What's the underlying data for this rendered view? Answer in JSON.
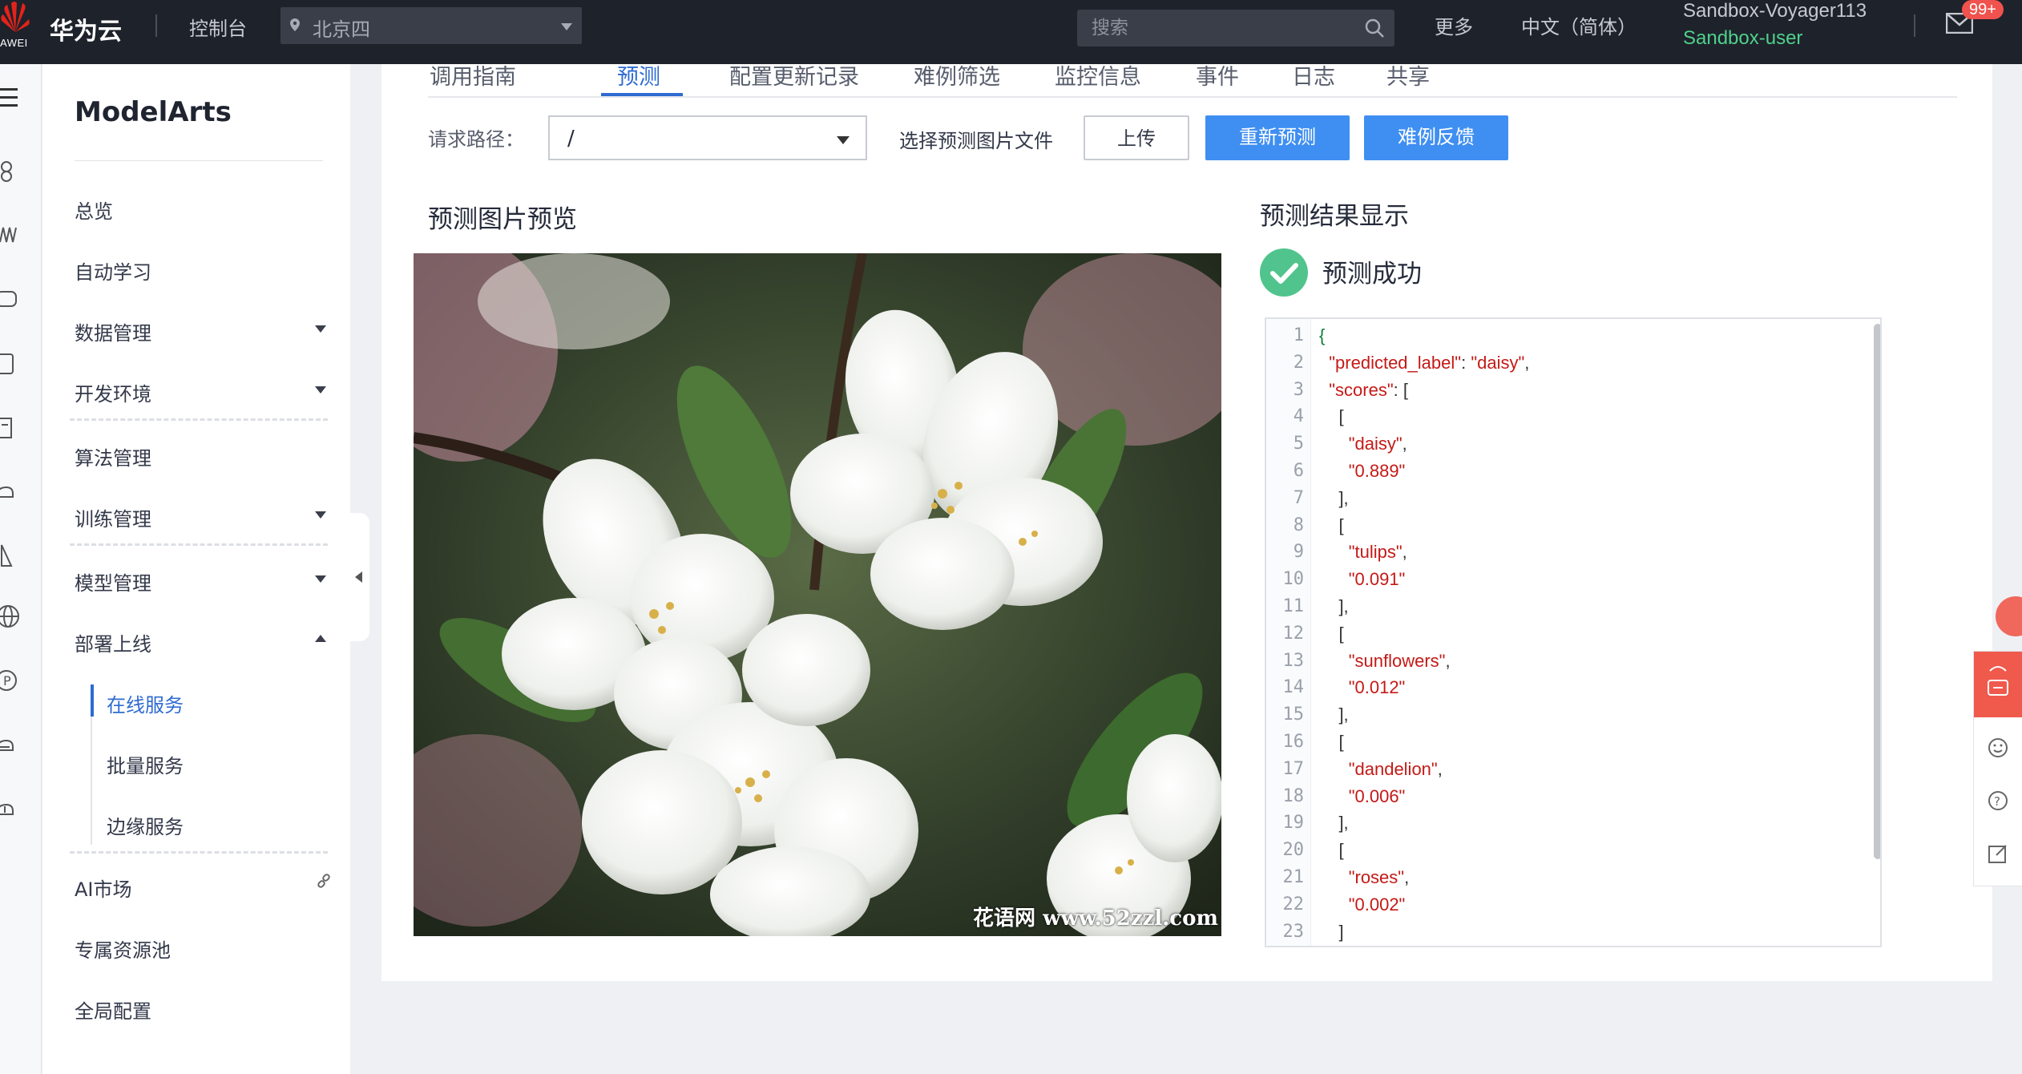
{
  "topbar": {
    "logo_text": "AWEI",
    "brand": "华为云",
    "console": "控制台",
    "region": "北京四",
    "search_placeholder": "搜索",
    "more": "更多",
    "language": "中文（简体）",
    "account": "Sandbox-Voyager113",
    "user": "Sandbox-user",
    "badge": "99+"
  },
  "sidenav": {
    "title": "ModelArts",
    "items": [
      {
        "label": "总览"
      },
      {
        "label": "自动学习"
      },
      {
        "label": "数据管理"
      },
      {
        "label": "开发环境"
      },
      {
        "label": "算法管理"
      },
      {
        "label": "训练管理"
      },
      {
        "label": "模型管理"
      },
      {
        "label": "部署上线"
      },
      {
        "label": "AI市场"
      },
      {
        "label": "专属资源池"
      },
      {
        "label": "全局配置"
      }
    ],
    "deploy_sub": [
      {
        "label": "在线服务",
        "active": true
      },
      {
        "label": "批量服务"
      },
      {
        "label": "边缘服务"
      }
    ]
  },
  "tabs": [
    "调用指南",
    "预测",
    "配置更新记录",
    "难例筛选",
    "监控信息",
    "事件",
    "日志",
    "共享"
  ],
  "active_tab": "预测",
  "toolbar": {
    "request_path_label": "请求路径：",
    "request_path_value": "/",
    "choose_file_label": "选择预测图片文件",
    "upload": "上传",
    "repredict": "重新预测",
    "hard_example_feedback": "难例反馈"
  },
  "preview": {
    "title": "预测图片预览",
    "watermark": "花语网 www.52zzl.com"
  },
  "result": {
    "title": "预测结果显示",
    "status": "预测成功",
    "json_lines": [
      {
        "n": "1",
        "t": "{"
      },
      {
        "n": "2",
        "t": "  \"predicted_label\": \"daisy\","
      },
      {
        "n": "3",
        "t": "  \"scores\": ["
      },
      {
        "n": "4",
        "t": "    ["
      },
      {
        "n": "5",
        "t": "      \"daisy\","
      },
      {
        "n": "6",
        "t": "      \"0.889\""
      },
      {
        "n": "7",
        "t": "    ],"
      },
      {
        "n": "8",
        "t": "    ["
      },
      {
        "n": "9",
        "t": "      \"tulips\","
      },
      {
        "n": "10",
        "t": "      \"0.091\""
      },
      {
        "n": "11",
        "t": "    ],"
      },
      {
        "n": "12",
        "t": "    ["
      },
      {
        "n": "13",
        "t": "      \"sunflowers\","
      },
      {
        "n": "14",
        "t": "      \"0.012\""
      },
      {
        "n": "15",
        "t": "    ],"
      },
      {
        "n": "16",
        "t": "    ["
      },
      {
        "n": "17",
        "t": "      \"dandelion\","
      },
      {
        "n": "18",
        "t": "      \"0.006\""
      },
      {
        "n": "19",
        "t": "    ],"
      },
      {
        "n": "20",
        "t": "    ["
      },
      {
        "n": "21",
        "t": "      \"roses\","
      },
      {
        "n": "22",
        "t": "      \"0.002\""
      },
      {
        "n": "23",
        "t": "    ]"
      }
    ]
  },
  "colors": {
    "topbar": "#1e222b",
    "accent": "#2f6bd1",
    "primary_button": "#3f8ff2",
    "success": "#50c48c",
    "user_green": "#4fd18b"
  }
}
